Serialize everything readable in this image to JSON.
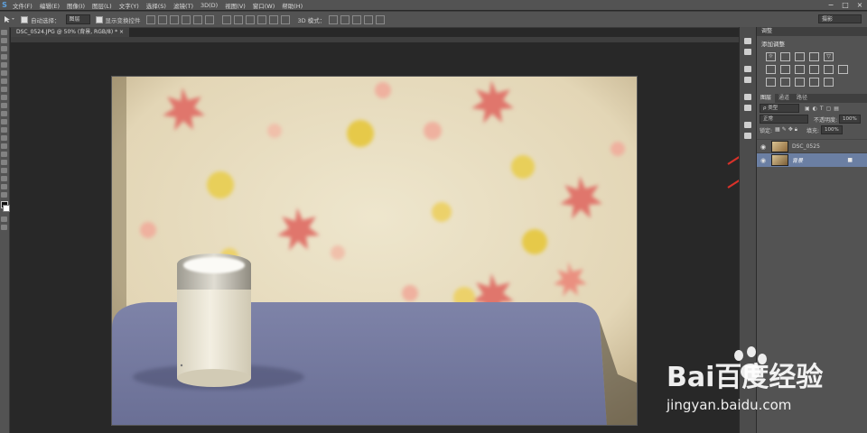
{
  "app": {
    "logo": "S"
  },
  "menu": {
    "items": [
      "文件(F)",
      "编辑(E)",
      "图像(I)",
      "图层(L)",
      "文字(Y)",
      "选择(S)",
      "滤镜(T)",
      "3D(D)",
      "视图(V)",
      "窗口(W)",
      "帮助(H)"
    ]
  },
  "window_controls": [
    "−",
    "□",
    "×"
  ],
  "options": {
    "auto_select_label": "自动选择：",
    "auto_select_value": "图层",
    "show_transform_label": "显示变换控件",
    "mode_3d_label": "3D 模式：",
    "workspace_value": "摄影"
  },
  "document": {
    "tab_title": "DSC_0524.JPG @ 50% (背景, RGB/8) * ×"
  },
  "adjustments": {
    "tab_label": "调整",
    "title": "添加调整"
  },
  "layers_panel": {
    "tabs": [
      "图层",
      "通道",
      "路径"
    ],
    "filter_kind": "ρ 类型",
    "blend_mode": "正常",
    "opacity_label": "不透明度:",
    "opacity_value": "100%",
    "lock_label": "锁定:",
    "fill_label": "填充:",
    "fill_value": "100%",
    "layers": [
      {
        "name": "DSC_0525",
        "selected": false,
        "locked": false
      },
      {
        "name": "背景",
        "selected": true,
        "locked": true
      }
    ]
  },
  "watermark": {
    "brand": "Bai百度经验",
    "url": "jingyan.baidu.com"
  },
  "colors": {
    "panel_bg": "#535353",
    "canvas_bg": "#282828",
    "selected_layer": "#6b7fa3",
    "annotation_arrow": "#d8322a"
  }
}
